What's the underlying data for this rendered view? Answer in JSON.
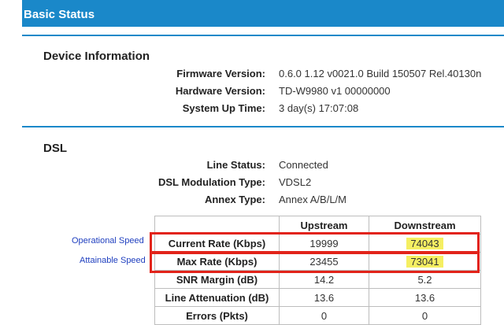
{
  "header": {
    "title": "Basic Status"
  },
  "device_info": {
    "title": "Device Information",
    "rows": [
      {
        "label": "Firmware Version:",
        "value": "0.6.0 1.12 v0021.0 Build 150507 Rel.40130n"
      },
      {
        "label": "Hardware Version:",
        "value": "TD-W9980 v1 00000000"
      },
      {
        "label": "System Up Time:",
        "value": "3 day(s) 17:07:08"
      }
    ]
  },
  "dsl": {
    "title": "DSL",
    "rows": [
      {
        "label": "Line Status:",
        "value": "Connected"
      },
      {
        "label": "DSL Modulation Type:",
        "value": "VDSL2"
      },
      {
        "label": "Annex Type:",
        "value": "Annex A/B/L/M"
      }
    ],
    "table": {
      "headers": [
        "",
        "Upstream",
        "Downstream"
      ],
      "rows": [
        {
          "label": "Current Rate (Kbps)",
          "up": "19999",
          "down": "74043"
        },
        {
          "label": "Max Rate (Kbps)",
          "up": "23455",
          "down": "73041"
        },
        {
          "label": "SNR Margin (dB)",
          "up": "14.2",
          "down": "5.2"
        },
        {
          "label": "Line Attenuation (dB)",
          "up": "13.6",
          "down": "13.6"
        },
        {
          "label": "Errors (Pkts)",
          "up": "0",
          "down": "0"
        }
      ]
    }
  },
  "annotations": {
    "operational": "Operational Speed",
    "attainable": "Attainable Speed"
  },
  "colors": {
    "accent": "#1a88c9",
    "highlight": "#f5ef62",
    "annotation_box": "#e2231a",
    "annotation_text": "#1f3fbf"
  }
}
